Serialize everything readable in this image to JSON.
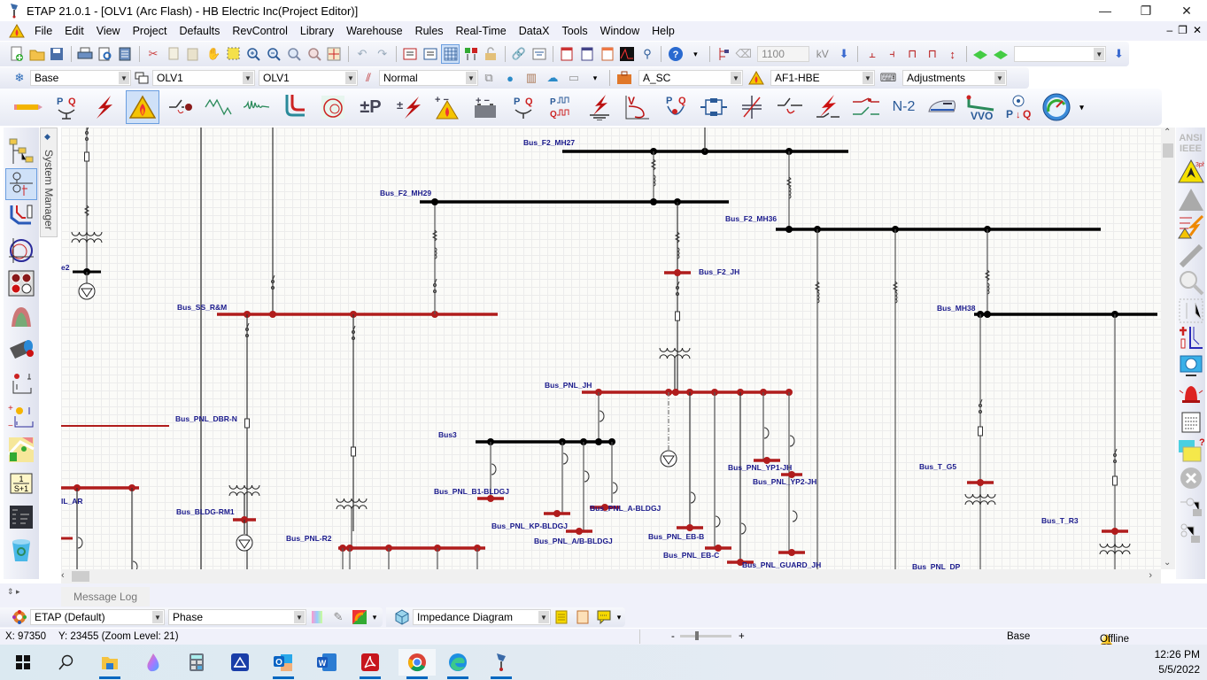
{
  "window": {
    "title": "ETAP 21.0.1 - [OLV1 (Arc Flash) - HB Electric Inc(Project Editor)]",
    "controls": {
      "minimize": "—",
      "restore": "❐",
      "close": "✕"
    },
    "mdi_controls": {
      "minimize": "‒",
      "restore": "❐",
      "close": "✕"
    }
  },
  "menu": [
    "File",
    "Edit",
    "View",
    "Project",
    "Defaults",
    "RevControl",
    "Library",
    "Warehouse",
    "Rules",
    "Real-Time",
    "DataX",
    "Tools",
    "Window",
    "Help"
  ],
  "toolbar_row1": {
    "icons": [
      "new-project",
      "open-project",
      "save",
      "print",
      "print-preview",
      "batch-print",
      "cut",
      "copy",
      "paste",
      "pan-hand",
      "select-zoom",
      "zoom-in",
      "zoom-out",
      "zoom-previous",
      "zoom-window",
      "zoom-fit",
      "undo",
      "redo",
      "text-box",
      "text-box-2",
      "grid",
      "check-continuity",
      "lock",
      "hyperlink",
      "theme",
      "report-1",
      "report-2",
      "report-3",
      "scope",
      "find",
      "help"
    ],
    "voltage_value": "1100",
    "voltage_unit": "kV",
    "right_combo_value": ""
  },
  "toolbar_row2": {
    "presentation": "Base",
    "display_options": "OLV1",
    "olv": "OLV1",
    "config": "Normal",
    "study_case": "A_SC",
    "arc_flash_case": "AF1-HBE",
    "revision": "Adjustments"
  },
  "study_toolbar": {
    "items": [
      {
        "name": "edit-mode",
        "glyph": "✎"
      },
      {
        "name": "load-flow",
        "glyph": "PQ"
      },
      {
        "name": "short-circuit",
        "glyph": "⚡"
      },
      {
        "name": "arc-flash",
        "glyph": "▲",
        "active": true
      },
      {
        "name": "motor-acceleration",
        "glyph": "⊘"
      },
      {
        "name": "harmonics",
        "glyph": "∿"
      },
      {
        "name": "transient-stability",
        "glyph": "〰"
      },
      {
        "name": "star-protection",
        "glyph": "⌊"
      },
      {
        "name": "cable-pulling",
        "glyph": "◎"
      },
      {
        "name": "dc-load-flow",
        "glyph": "±P"
      },
      {
        "name": "dc-short-circuit",
        "glyph": "±⚡"
      },
      {
        "name": "dc-arc-flash",
        "glyph": "±▲"
      },
      {
        "name": "battery-sizing",
        "glyph": "▭"
      },
      {
        "name": "unbalanced-load-flow",
        "glyph": "PQ"
      },
      {
        "name": "time-domain-load-flow",
        "glyph": "PQ"
      },
      {
        "name": "ground-grid",
        "glyph": "⏚"
      },
      {
        "name": "voltage-stability",
        "glyph": "V"
      },
      {
        "name": "reactive-power",
        "glyph": "PQ"
      },
      {
        "name": "reliability",
        "glyph": "⧉"
      },
      {
        "name": "optimal-capacitor",
        "glyph": "✕"
      },
      {
        "name": "switching-sequence",
        "glyph": "⤳"
      },
      {
        "name": "contingency",
        "glyph": "⚡"
      },
      {
        "name": "switching-interlock",
        "glyph": "⇌"
      },
      {
        "name": "n-2-contingency",
        "glyph": "N-2"
      },
      {
        "name": "railway",
        "glyph": "🚄"
      },
      {
        "name": "vvo",
        "glyph": "VVO"
      },
      {
        "name": "p-q-control",
        "glyph": "P↓Q"
      },
      {
        "name": "dashboard",
        "glyph": "◔"
      }
    ]
  },
  "left_toolbar": {
    "items": [
      "project-view",
      "one-line-view",
      "star-view",
      "cable-view",
      "ground-grid-view",
      "underground-raceway",
      "cable-pulling",
      "control-circuit",
      "dc-circuit",
      "gis-map",
      "transfer-function",
      "user-defined",
      "recycle-bin"
    ]
  },
  "system_manager_label": "System Manager",
  "right_toolbar": {
    "standard": "ANSI\nIEEE",
    "items": [
      "run-arc-flash-3ph",
      "run-arc-flash-1ph",
      "arc-flash-sequence",
      "arc-flash-update",
      "alert-view",
      "quick-view",
      "star-sequence",
      "one-line-tcc",
      "display-options",
      "alert",
      "report-manager",
      "help-report",
      "stop",
      "get-online",
      "get-offline"
    ]
  },
  "diagram": {
    "buses": [
      "Bus_F2_MH27",
      "Bus_F2_MH29",
      "Bus_F2_MH36",
      "Bus_F2_JH",
      "Bus_MH38",
      "Bus_SS_R&M",
      "Bus_PNL_DBR-N",
      "Bus_PNL_JH",
      "Bus3",
      "Bus_PNL_B1-BLDGJ",
      "Bus_PNL_KP-BLDGJ",
      "Bus_PNL_A-BLDGJ",
      "Bus_PNL_A/B-BLDGJ",
      "Bus_PNL_YP1-JH",
      "Bus_PNL_YP2-JH",
      "Bus_PNL_EB-B",
      "Bus_PNL_EB-C",
      "Bus_PNL_GUARD_JH",
      "Bus_BLDG-RM1",
      "Bus_PNL-R2",
      "Bus_T_G5",
      "Bus_T_R3",
      "Bus_PNL_DP",
      "e2",
      "IL_AR"
    ],
    "colors": {
      "energized_bus": "#b01c1c",
      "normal_bus": "#000000",
      "label": "#1a1a8c"
    }
  },
  "message_log_tab": "Message Log",
  "bottom_toolbar": {
    "theme": "ETAP (Default)",
    "phase": "Phase",
    "diagram_type": "Impedance Diagram"
  },
  "status": {
    "x": "X: 97350",
    "y": "Y: 23455 (Zoom Level: 21)",
    "zoom_minus": "-",
    "zoom_plus": "+",
    "zoom_slider_fraction": 0.3,
    "presentation": "Base",
    "connection": "Offline"
  },
  "taskbar": {
    "items": [
      "start",
      "search",
      "file-explorer",
      "paint",
      "calculator",
      "scanner",
      "outlook",
      "word",
      "acrobat",
      "chrome",
      "edge",
      "etap"
    ],
    "time": "12:26 PM",
    "date": "5/5/2022"
  }
}
